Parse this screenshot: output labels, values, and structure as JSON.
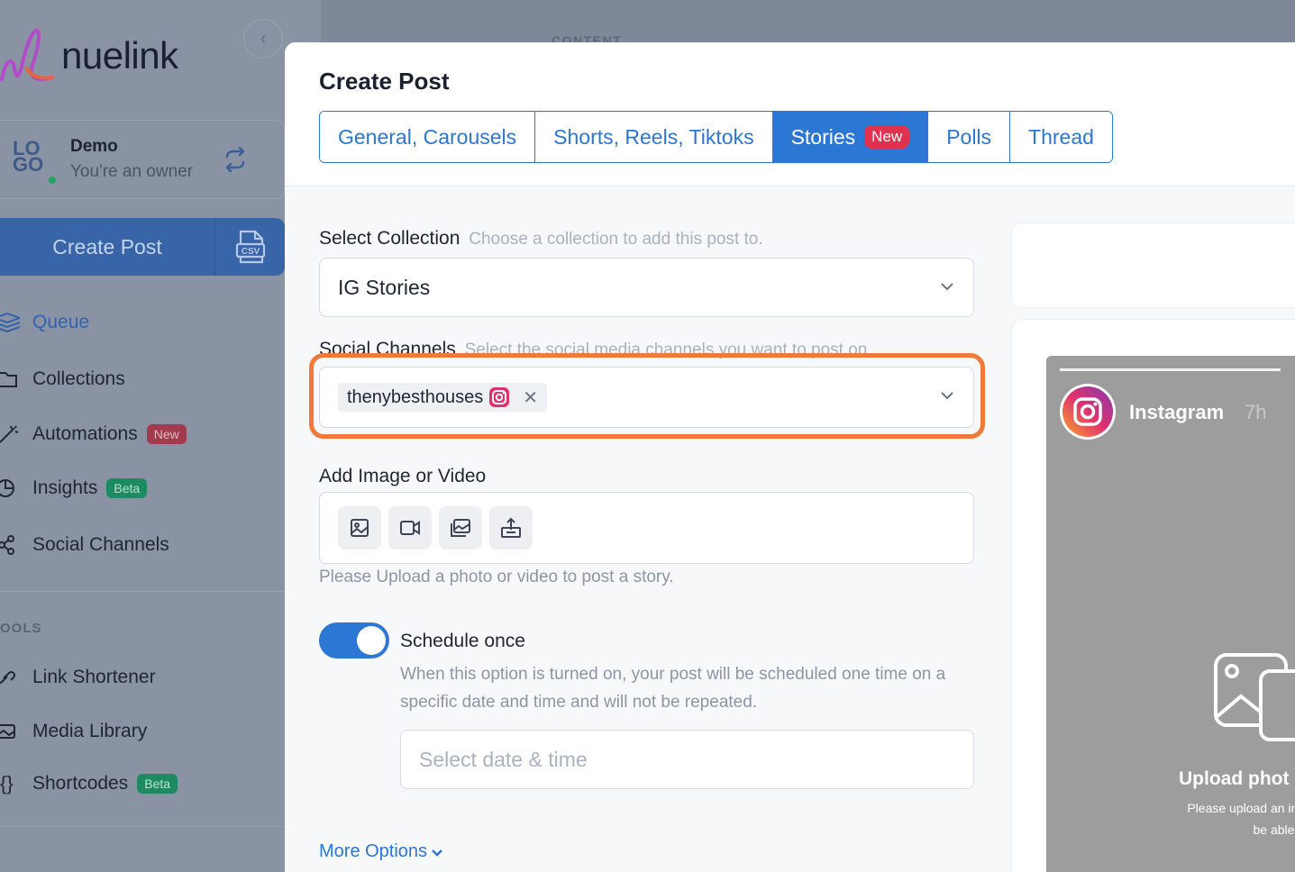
{
  "brand": {
    "name": "nuelink"
  },
  "background": {
    "content_label": "CONTENT"
  },
  "account": {
    "logo_text": "LO GO",
    "name": "Demo",
    "role": "You're an owner"
  },
  "sidebar": {
    "create_button": "Create Post",
    "items": [
      {
        "label": "Queue",
        "icon": "layers-icon",
        "active": true
      },
      {
        "label": "Collections",
        "icon": "folder-icon"
      },
      {
        "label": "Automations",
        "icon": "magic-wand-icon",
        "badge": "New"
      },
      {
        "label": "Insights",
        "icon": "pie-chart-icon",
        "badge": "Beta"
      },
      {
        "label": "Social Channels",
        "icon": "share-icon"
      }
    ],
    "tools_label": "OOLS",
    "tools": [
      {
        "label": "Link Shortener",
        "icon": "link-icon"
      },
      {
        "label": "Media Library",
        "icon": "images-icon"
      },
      {
        "label": "Shortcodes",
        "icon": "braces-icon",
        "badge": "Beta"
      }
    ]
  },
  "modal": {
    "title": "Create Post",
    "tabs": [
      {
        "label": "General, Carousels"
      },
      {
        "label": "Shorts, Reels, Tiktoks"
      },
      {
        "label": "Stories",
        "badge": "New",
        "active": true
      },
      {
        "label": "Polls"
      },
      {
        "label": "Thread"
      }
    ],
    "collection": {
      "label": "Select Collection",
      "hint": "Choose a collection to add this post to.",
      "value": "IG Stories"
    },
    "channels": {
      "label": "Social Channels",
      "hint": "Select the social media channels you want to post on",
      "selected": "thenybesthouses"
    },
    "media": {
      "label": "Add Image or Video",
      "helper": "Please Upload a photo or video to post a story."
    },
    "schedule": {
      "enabled": true,
      "title": "Schedule once",
      "description": "When this option is turned on, your post will be scheduled one time on a specific date and time and will not be repeated.",
      "date_placeholder": "Select date & time"
    },
    "more_options": "More Options"
  },
  "preview": {
    "platform": "Instagram",
    "time": "7h",
    "upload_title": "Upload phot",
    "upload_line1": "Please upload an ima",
    "upload_line2": "be able to"
  },
  "colors": {
    "accent": "#2c76d4",
    "highlight": "#f27a38",
    "new_badge": "#e0314f",
    "beta_badge": "#1e8a62"
  }
}
